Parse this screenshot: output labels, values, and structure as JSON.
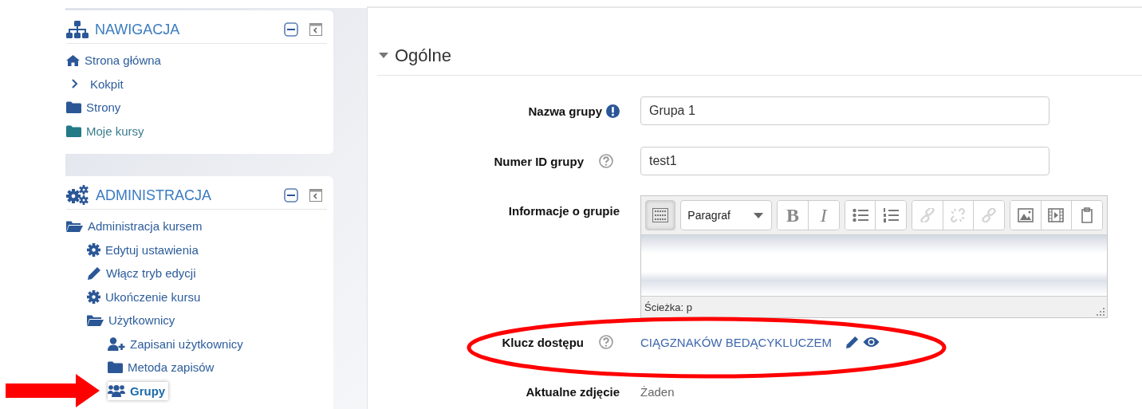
{
  "navigation_block": {
    "title": "NAWIGACJA",
    "items": [
      {
        "label": "Strona główna",
        "kind": "home",
        "selected": false
      },
      {
        "label": "Kokpit",
        "kind": "branch",
        "expanded": false,
        "selected": false
      },
      {
        "label": "Strony",
        "kind": "folder",
        "expanded": false,
        "selected": false
      },
      {
        "label": "Moje kursy",
        "kind": "course-folder",
        "selected": false
      }
    ]
  },
  "administration_block": {
    "title": "ADMINISTRACJA",
    "items": [
      {
        "label": "Administracja kursem",
        "kind": "folder",
        "expanded": true,
        "selected": false,
        "children": [
          {
            "label": "Edytuj ustawienia",
            "kind": "gear",
            "selected": false
          },
          {
            "label": "Włącz tryb edycji",
            "kind": "pencil",
            "selected": false
          },
          {
            "label": "Ukończenie kursu",
            "kind": "gear",
            "selected": false
          },
          {
            "label": "Użytkownicy",
            "kind": "folder",
            "expanded": true,
            "selected": false,
            "children": [
              {
                "label": "Zapisani użytkownicy",
                "kind": "user-add",
                "selected": false
              },
              {
                "label": "Metoda zapisów",
                "kind": "folder",
                "expanded": false,
                "selected": false
              },
              {
                "label": "Grupy",
                "kind": "users",
                "selected": true
              }
            ]
          }
        ]
      }
    ]
  },
  "section": {
    "title": "Ogólne",
    "expanded": true,
    "fields": [
      {
        "kind": "text",
        "label": "Nazwa grupy",
        "required": true,
        "help": false,
        "value": "Grupa 1"
      },
      {
        "kind": "text",
        "label": "Numer ID grupy",
        "required": false,
        "help": true,
        "value": "test1"
      },
      {
        "kind": "editor",
        "label": "Informacje o grupie",
        "required": false,
        "help": false,
        "toolbar": {
          "toggle_pressed": true,
          "format": "Paragraf",
          "groups": [
            [
              {
                "kind": "bold",
                "label": "B",
                "disabled": false
              },
              {
                "kind": "italic",
                "label": "I",
                "disabled": false
              }
            ],
            [
              {
                "kind": "bullets",
                "disabled": false
              },
              {
                "kind": "numbers",
                "disabled": false
              }
            ],
            [
              {
                "kind": "link",
                "disabled": true
              },
              {
                "kind": "unlink",
                "disabled": true
              },
              {
                "kind": "anchor",
                "disabled": true
              }
            ],
            [
              {
                "kind": "image",
                "disabled": false
              },
              {
                "kind": "media",
                "disabled": false
              },
              {
                "kind": "paste",
                "disabled": false
              }
            ]
          ]
        },
        "path": "Ścieżka: p"
      },
      {
        "kind": "secret",
        "label": "Klucz dostępu",
        "required": false,
        "help": true,
        "value": "CIĄGZNAKÓW BEDĄCYKLUCZEM"
      },
      {
        "kind": "static",
        "label": "Aktualne zdjęcie",
        "required": false,
        "help": false,
        "value": "Żaden"
      }
    ]
  }
}
